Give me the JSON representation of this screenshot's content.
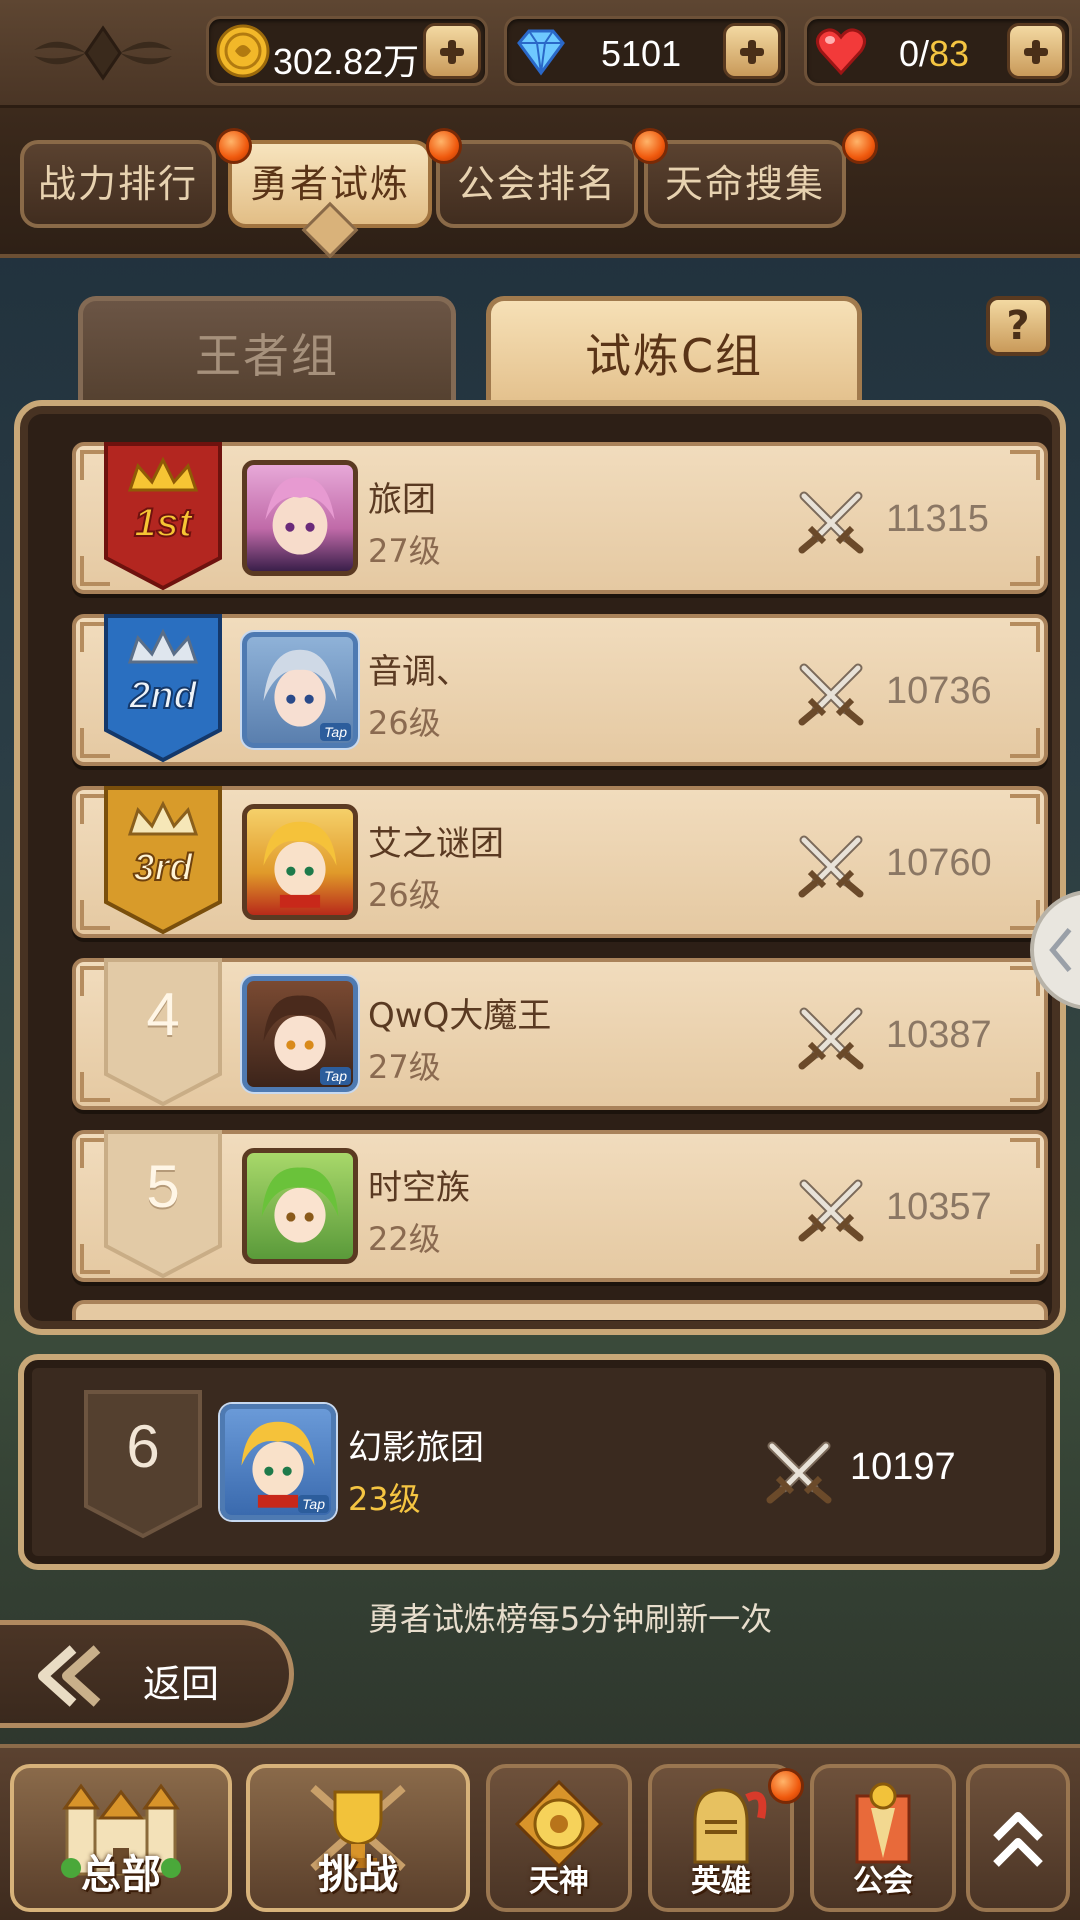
{
  "resources": {
    "gold": {
      "icon": "gold-coin-icon",
      "value": "302.82万"
    },
    "diamond": {
      "icon": "diamond-icon",
      "value": "5101"
    },
    "stamina": {
      "icon": "heart-icon",
      "current": "0/",
      "max": "83"
    }
  },
  "tabs": [
    {
      "label": "战力排行",
      "active": false
    },
    {
      "label": "勇者试炼",
      "active": true
    },
    {
      "label": "公会排名",
      "active": false
    },
    {
      "label": "天命搜集",
      "active": false
    }
  ],
  "groups": {
    "left": "王者组",
    "right": "试炼C组",
    "help": "?"
  },
  "ranking": [
    {
      "rank": "1st",
      "name": "旅团",
      "level": "27级",
      "power": "11315",
      "badge": "gold-red"
    },
    {
      "rank": "2nd",
      "name": "音调、",
      "level": "26级",
      "power": "10736",
      "badge": "silver-blue"
    },
    {
      "rank": "3rd",
      "name": "艾之谜团",
      "level": "26级",
      "power": "10760",
      "badge": "bronze-gold"
    },
    {
      "rank": "4",
      "name": "QwQ大魔王",
      "level": "27级",
      "power": "10387",
      "badge": "plain"
    },
    {
      "rank": "5",
      "name": "时空族",
      "level": "22级",
      "power": "10357",
      "badge": "plain"
    }
  ],
  "my_rank": {
    "rank": "6",
    "name": "幻影旅团",
    "level": "23级",
    "power": "10197"
  },
  "tap_label": "Tap",
  "refresh_note": "勇者试炼榜每5分钟刷新一次",
  "back_label": "返回",
  "bottom_nav": [
    {
      "label": "总部",
      "icon": "castle-icon"
    },
    {
      "label": "挑战",
      "icon": "trophy-icon"
    },
    {
      "label": "天神",
      "icon": "deity-emblem-icon"
    },
    {
      "label": "英雄",
      "icon": "knight-helmet-icon"
    },
    {
      "label": "公会",
      "icon": "guild-banner-icon"
    }
  ],
  "colors": {
    "accent_gold": "#f5c542",
    "notify_orange": "#f05a0e",
    "row_bg": "#f1dcbd"
  }
}
